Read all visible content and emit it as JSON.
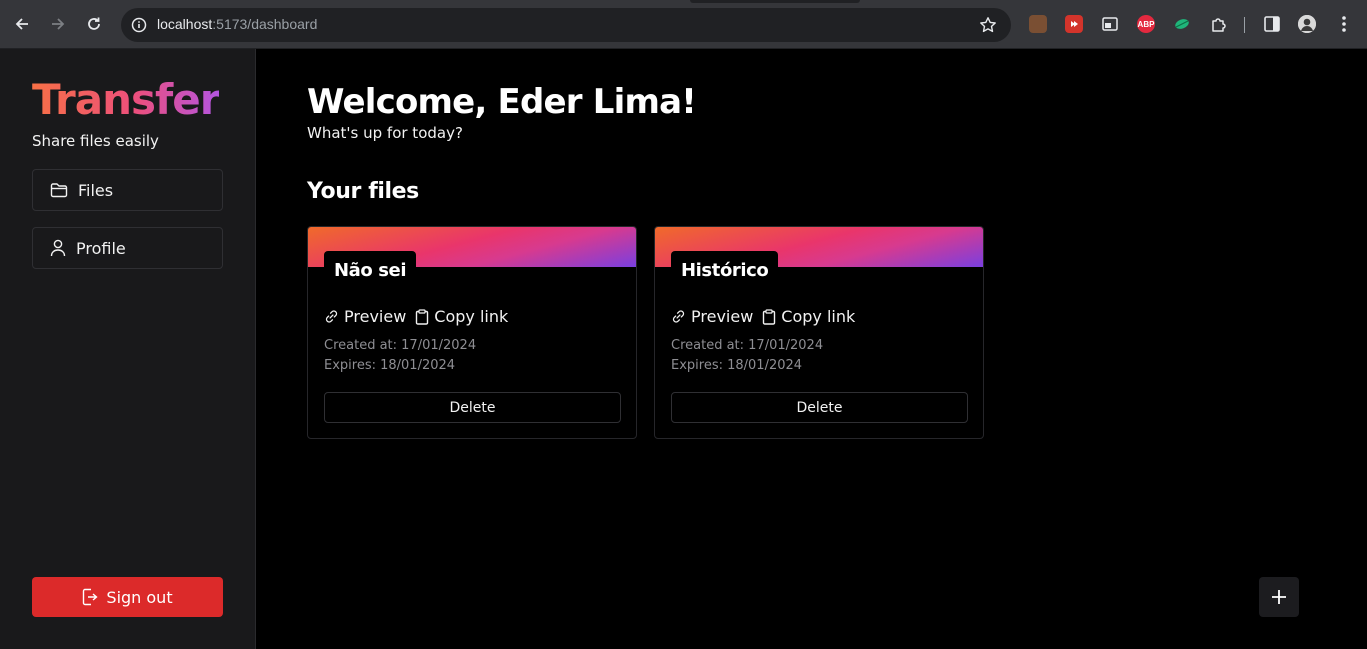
{
  "browser": {
    "url_host": "localhost",
    "url_rest": ":5173/dashboard",
    "extensions": [
      {
        "name": "bear-extension-icon",
        "color": "#8a5a3c",
        "label": ""
      },
      {
        "name": "video-extension-icon",
        "color": "#d3342b",
        "label": ""
      },
      {
        "name": "window-extension-icon",
        "color": "#35363a",
        "label": ""
      },
      {
        "name": "adblock-extension-icon",
        "color": "#e3293f",
        "label": "ABP"
      },
      {
        "name": "leaf-extension-icon",
        "color": "#35363a",
        "label": ""
      }
    ]
  },
  "sidebar": {
    "brand": "Transfer",
    "tagline": "Share files easily",
    "items": [
      {
        "label": "Files",
        "icon": "folder-icon"
      },
      {
        "label": "Profile",
        "icon": "user-icon"
      }
    ],
    "signout_label": "Sign out"
  },
  "main": {
    "welcome": "Welcome, Eder Lima!",
    "subtitle": "What's up for today?",
    "section_title": "Your files",
    "files": [
      {
        "name": "Não sei",
        "preview_label": "Preview",
        "copy_label": "Copy link",
        "created": "Created at: 17/01/2024",
        "expires": "Expires: 18/01/2024",
        "delete_label": "Delete"
      },
      {
        "name": "Histórico",
        "preview_label": "Preview",
        "copy_label": "Copy link",
        "created": "Created at: 17/01/2024",
        "expires": "Expires: 18/01/2024",
        "delete_label": "Delete"
      }
    ]
  },
  "colors": {
    "signout_bg": "#dc2a2a",
    "sidebar_bg": "#19191b",
    "brand_gradient_start": "#f87046",
    "brand_gradient_end": "#b455e0"
  }
}
